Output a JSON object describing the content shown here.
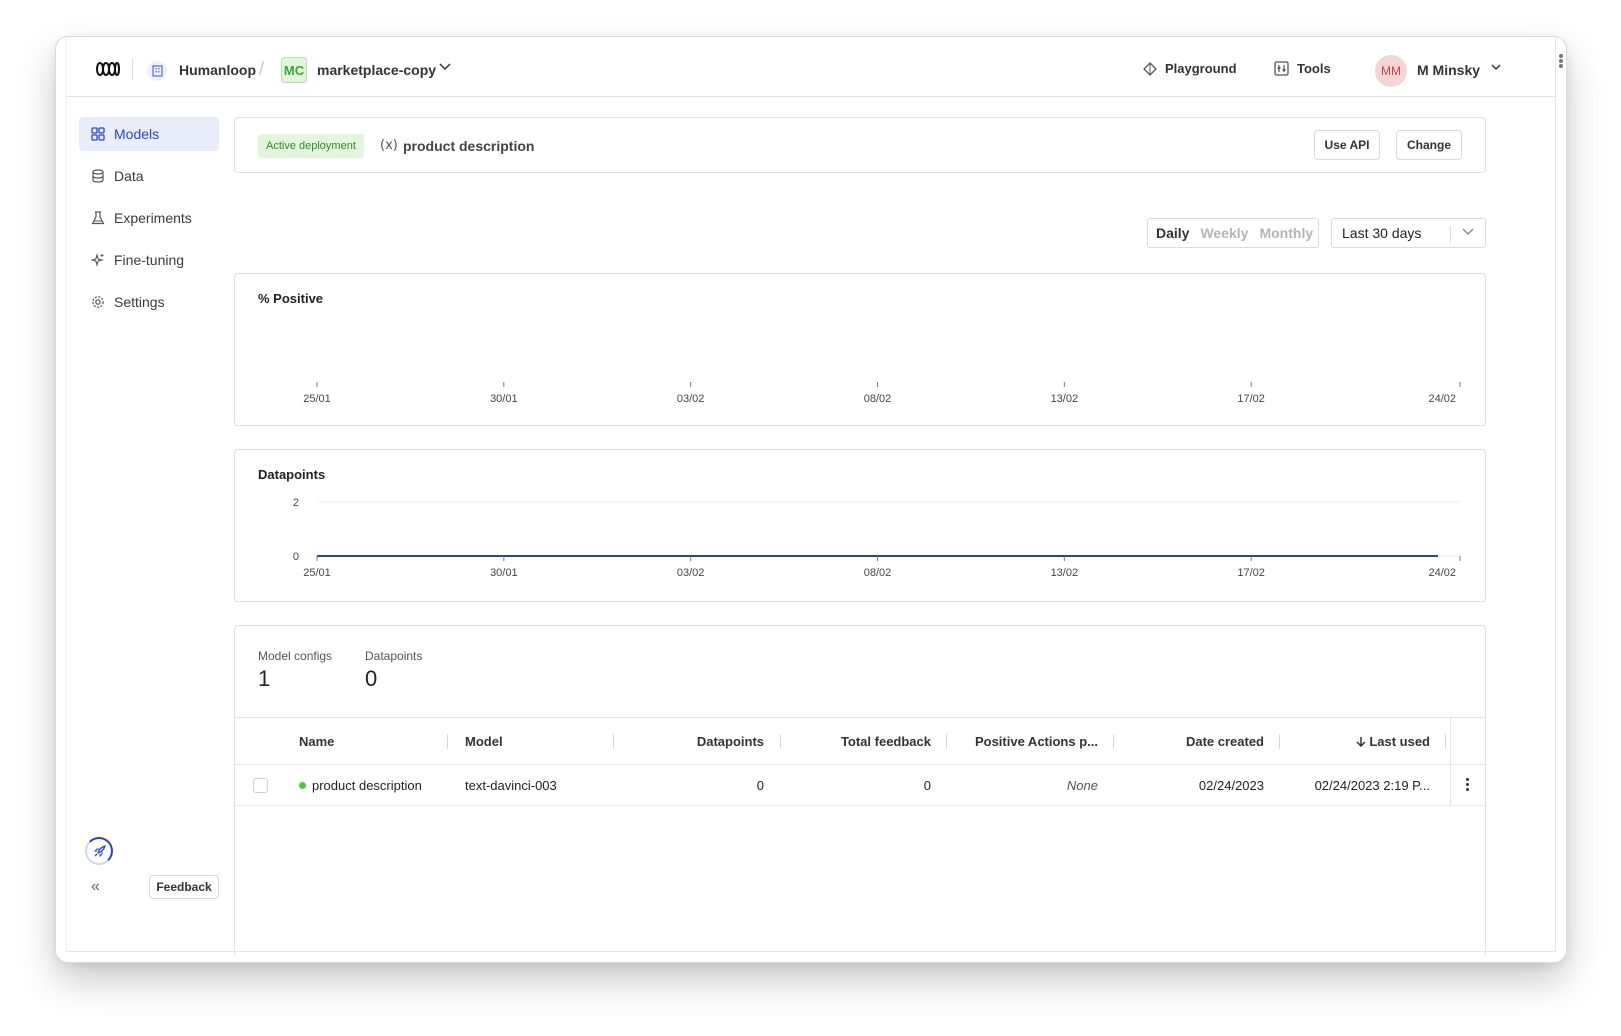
{
  "header": {
    "org_name": "Humanloop",
    "breadcrumb_separator": "/",
    "project_badge": "MC",
    "project_name": "marketplace-copy",
    "playground_label": "Playground",
    "tools_label": "Tools",
    "user_initials": "MM",
    "user_name": "M Minsky"
  },
  "sidebar": {
    "items": [
      {
        "label": "Models",
        "icon": "grid-icon",
        "active": true
      },
      {
        "label": "Data",
        "icon": "database-icon",
        "active": false
      },
      {
        "label": "Experiments",
        "icon": "flask-icon",
        "active": false
      },
      {
        "label": "Fine-tuning",
        "icon": "sparkle-icon",
        "active": false
      },
      {
        "label": "Settings",
        "icon": "gear-icon",
        "active": false
      }
    ],
    "feedback_label": "Feedback"
  },
  "deployment": {
    "badge": "Active deployment",
    "name": "product description",
    "use_api_label": "Use API",
    "change_label": "Change"
  },
  "period_toggle": {
    "options": [
      "Daily",
      "Weekly",
      "Monthly"
    ],
    "selected": "Daily"
  },
  "range_select": {
    "value": "Last 30 days"
  },
  "chart_data": [
    {
      "type": "line",
      "title": "% Positive",
      "x": [
        "25/01",
        "30/01",
        "03/02",
        "08/02",
        "13/02",
        "17/02",
        "24/02"
      ],
      "series": [],
      "grid": false
    },
    {
      "type": "line",
      "title": "Datapoints",
      "x": [
        "25/01",
        "30/01",
        "03/02",
        "08/02",
        "13/02",
        "17/02",
        "24/02"
      ],
      "y_ticks": [
        0,
        2
      ],
      "ylim": [
        0,
        2
      ],
      "series": [
        {
          "values": [
            0,
            0,
            0,
            0,
            0,
            0,
            0
          ],
          "color": "#2a3fb0"
        }
      ],
      "grid": true
    }
  ],
  "stats": {
    "model_configs_label": "Model configs",
    "model_configs_value": "1",
    "datapoints_label": "Datapoints",
    "datapoints_value": "0"
  },
  "table": {
    "columns": {
      "name": "Name",
      "model": "Model",
      "datapoints": "Datapoints",
      "total_feedback": "Total feedback",
      "positive_actions": "Positive Actions p...",
      "date_created": "Date created",
      "last_used": "Last used"
    },
    "rows": [
      {
        "name": "product description",
        "model": "text-davinci-003",
        "datapoints": "0",
        "total_feedback": "0",
        "positive_actions": "None",
        "date_created": "02/24/2023",
        "last_used": "02/24/2023 2:19 P..."
      }
    ]
  }
}
